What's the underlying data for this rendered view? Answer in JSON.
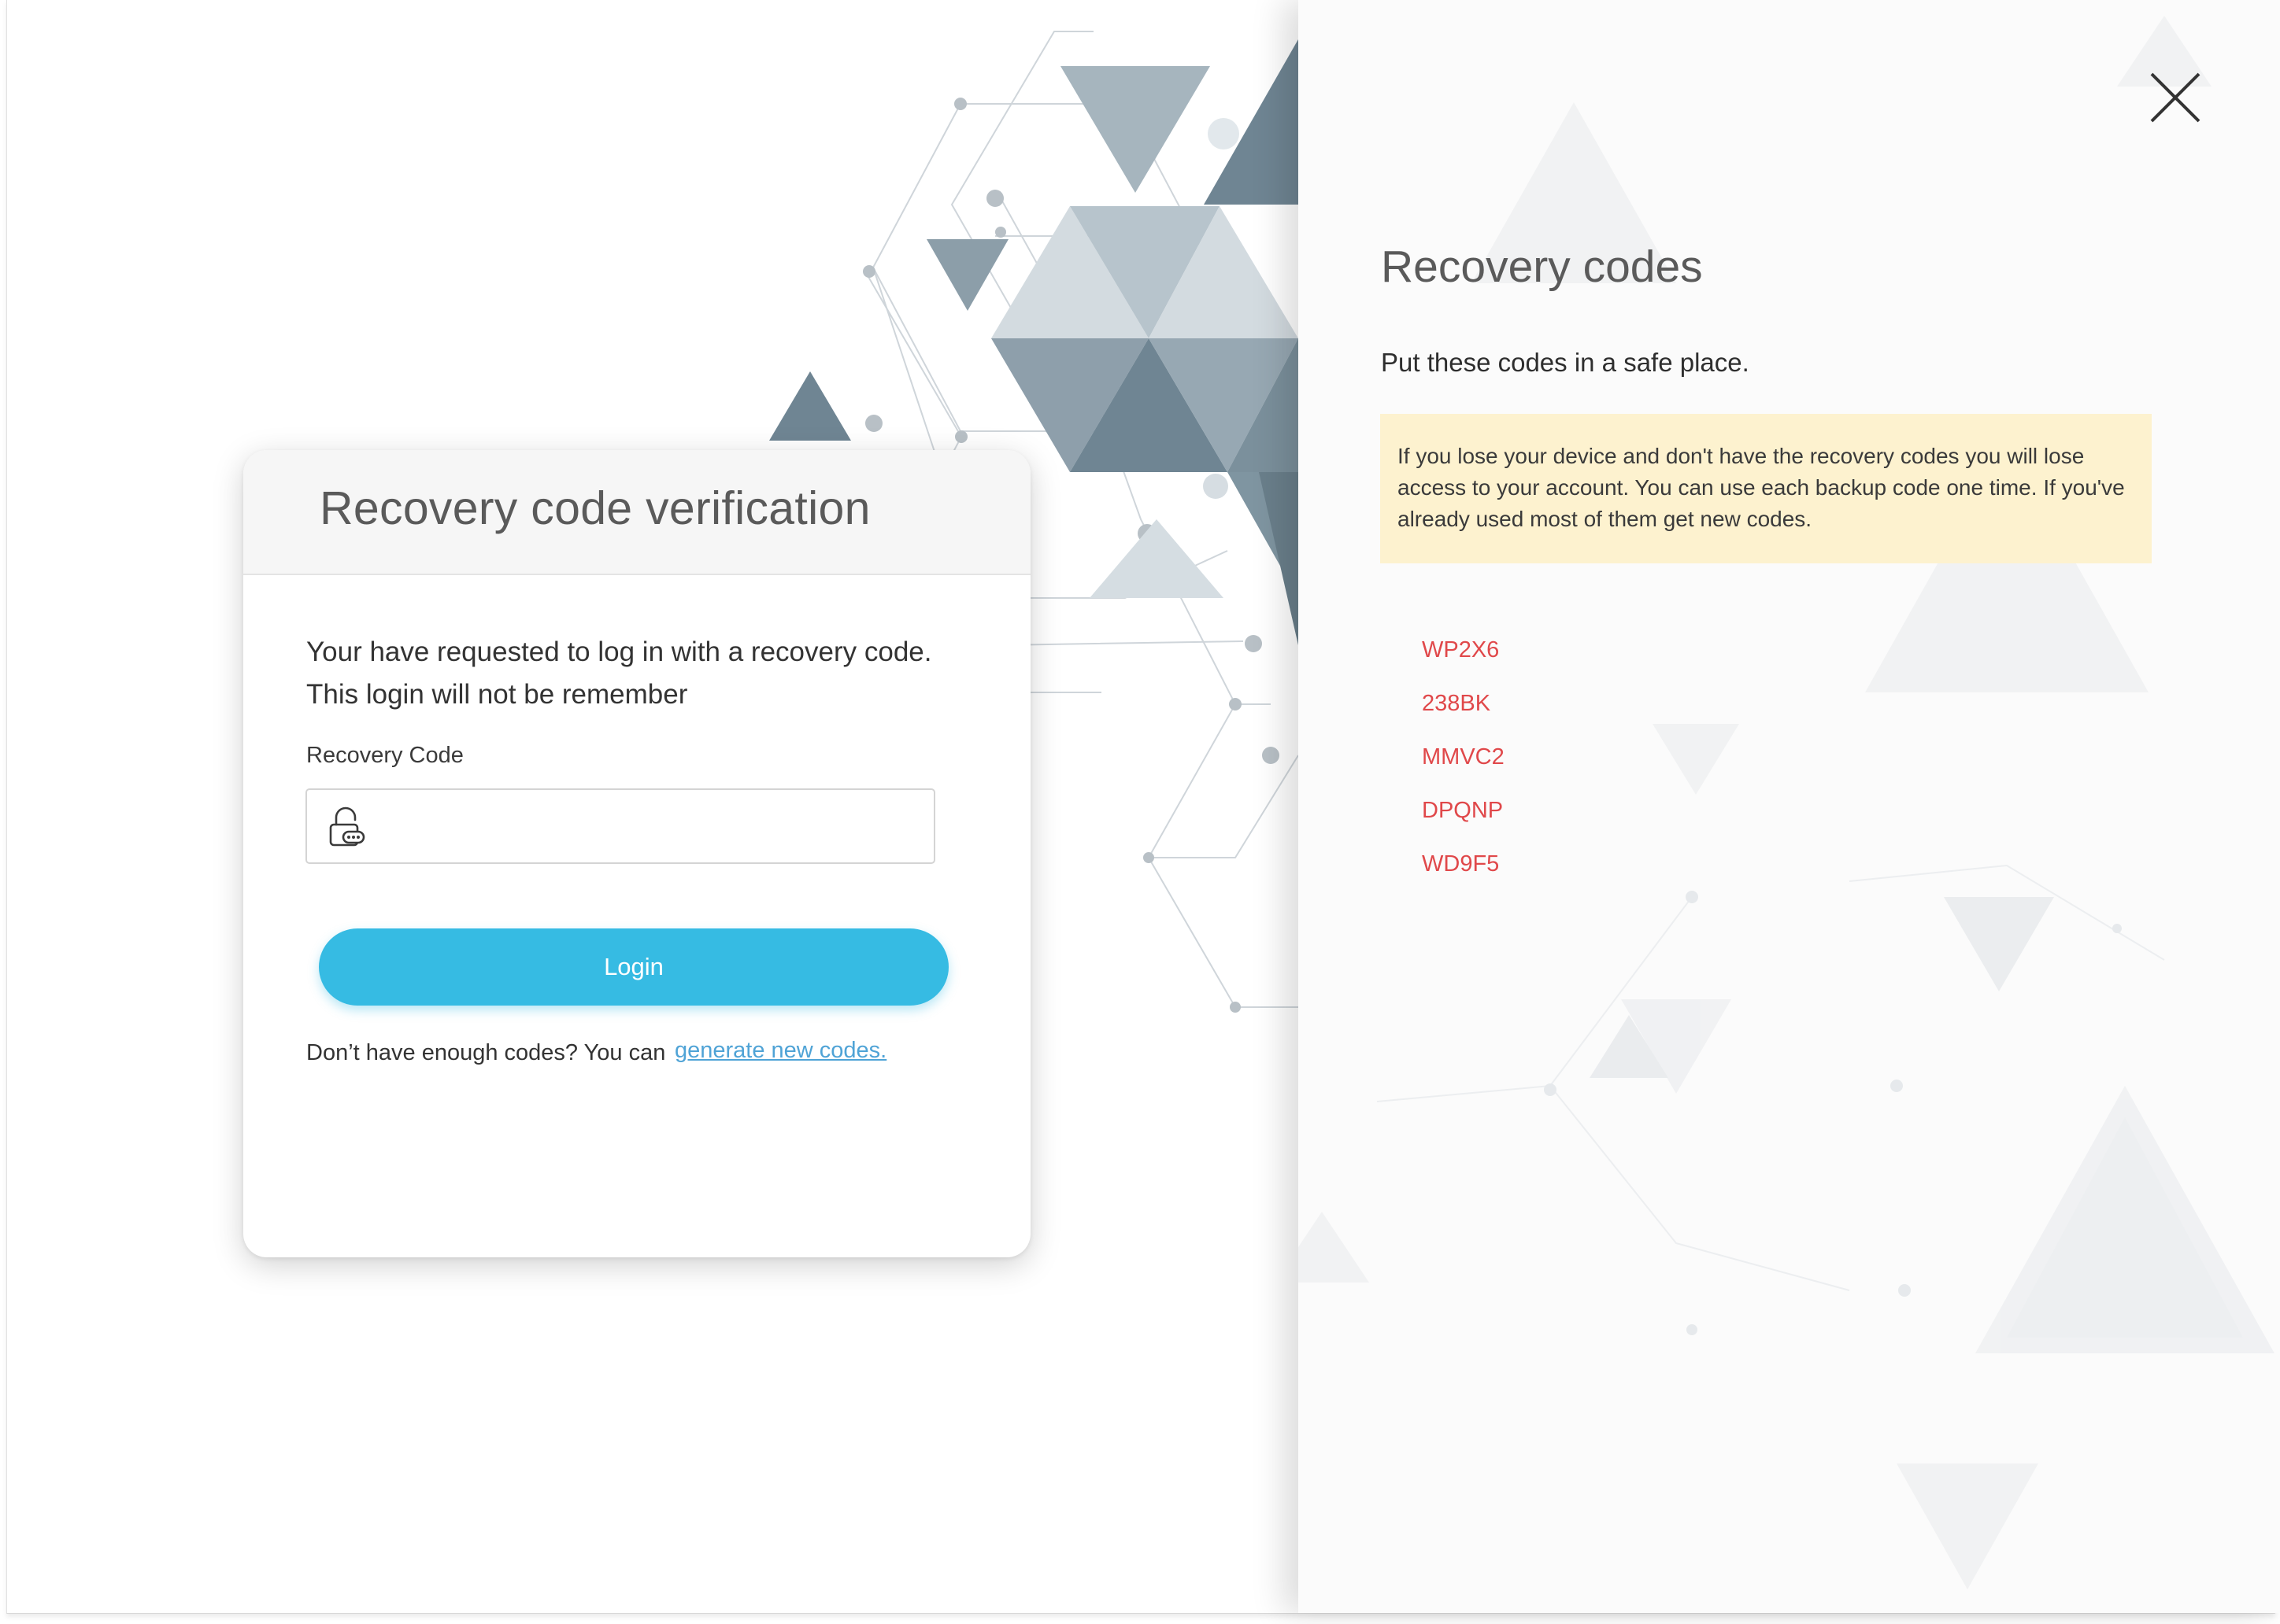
{
  "login_card": {
    "title": "Recovery code verification",
    "intro_line1": "Your have requested to log in with a recovery code.",
    "intro_line2": "This login will not be remember",
    "field_label": "Recovery Code",
    "input_value": "",
    "input_placeholder": "",
    "login_button": "Login",
    "footer_text": "Don’t have enough codes? You can",
    "footer_link": "generate new codes.",
    "icons": {
      "input": "lock-icon"
    }
  },
  "recovery_panel": {
    "title": "Recovery codes",
    "subtitle": "Put these codes in a safe place.",
    "warning": "If you lose your device and don't have the recovery codes you will lose access to your account. You can use each backup code one time. If you've already used most of them get new codes.",
    "codes": [
      "WP2X6",
      "238BK",
      "MMVC2",
      "DPQNP",
      "WD9F5"
    ],
    "icons": {
      "close": "close-icon"
    }
  },
  "colors": {
    "accent": "#36bbe3",
    "link": "#4fa3d6",
    "code_text": "#e0484a",
    "warning_bg": "#fdf2cf",
    "art_dark": "#6f8593",
    "art_light": "#c9d3da"
  }
}
